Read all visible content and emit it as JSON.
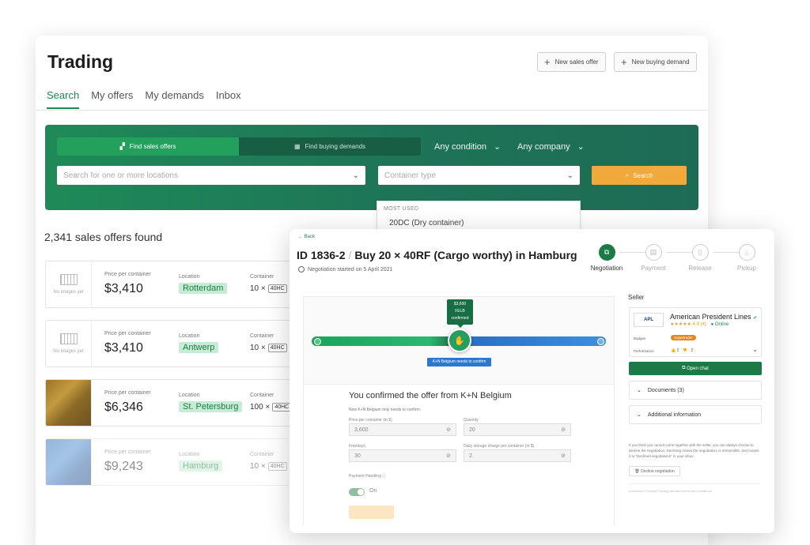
{
  "back_window": {
    "title": "Trading",
    "buttons": {
      "new_sales_offer": "New sales offer",
      "new_buying_demand": "New buying demand"
    },
    "tabs": [
      {
        "label": "Search",
        "active": true
      },
      {
        "label": "My offers",
        "active": false
      },
      {
        "label": "My demands",
        "active": false
      },
      {
        "label": "Inbox",
        "active": false
      }
    ],
    "search": {
      "find_sales": "Find sales offers",
      "find_buying": "Find buying demands",
      "condition": "Any condition",
      "company": "Any company",
      "location_placeholder": "Search for one or more locations",
      "container_placeholder": "Container type",
      "search_button": "Search",
      "dropdown_header": "MOST USED",
      "dropdown_option": "20DC (Dry container)"
    },
    "results_count": "2,341 sales offers found",
    "cards": [
      {
        "image_label": "No images yet",
        "price_label": "Price per container",
        "price": "$3,410",
        "location_label": "Location",
        "location": "Rotterdam",
        "container_label": "Container",
        "qty": "10 ×",
        "type": "40HC"
      },
      {
        "image_label": "No images yet",
        "price_label": "Price per container",
        "price": "$3,410",
        "location_label": "Location",
        "location": "Antwerp",
        "container_label": "Container",
        "qty": "10 ×",
        "type": "40HC"
      },
      {
        "image_label": "",
        "price_label": "Price per container",
        "price": "$6,346",
        "location_label": "Location",
        "location": "St. Petersburg",
        "container_label": "Container",
        "qty": "100 ×",
        "type": "40HC"
      },
      {
        "image_label": "",
        "price_label": "Price per container",
        "price": "$9,243",
        "location_label": "Location",
        "location": "Hamburg",
        "container_label": "Container",
        "qty": "10 ×",
        "type": "40HC"
      }
    ]
  },
  "front_window": {
    "back": "Back",
    "id": "ID 1836-2",
    "title": "Buy 20 × 40RF (Cargo worthy) in Hamburg",
    "started": "Negotiation started on 5 April 2021",
    "steps": [
      {
        "label": "Negotiation",
        "active": true
      },
      {
        "label": "Payment",
        "active": false
      },
      {
        "label": "Release",
        "active": false
      },
      {
        "label": "Pickup",
        "active": false
      }
    ],
    "flag": {
      "price": "$3,600",
      "term": "FELB",
      "status": "confirmed"
    },
    "needs_confirm": "K+N Belgium needs to confirm",
    "confirm_title": "You confirmed the offer from K+N Belgium",
    "confirm_sub": "Now K+N Belgium only needs to confirm.",
    "fields": {
      "price_label": "Price per container (in $)",
      "price": "3,600",
      "quantity_label": "Quantity",
      "quantity": "20",
      "freedays_label": "Freedays",
      "freedays": "30",
      "storage_label": "Daily storage charge per container (in $)",
      "storage": "2"
    },
    "payment_label": "Payment Handling",
    "toggle_state": "On",
    "seller": {
      "heading": "Seller",
      "logo": "APL",
      "name": "American President Lines",
      "rating": "★★★★★ 4.9 (4)",
      "online": "Online",
      "badges_label": "Badges",
      "badge": "Supertrader",
      "performance_label": "Performance",
      "perf_pos": "2",
      "perf_neg": "2",
      "open_chat": "Open chat",
      "documents": "Documents (3)",
      "additional": "Additional information",
      "decline_note": "If you think you cannot come together with the seller, you can always choose to decline the negotiation. Declining closes the negotiation, is irreversible, and moves it to \"Declined negotiations\" in your inbox.",
      "decline_button": "Decline negotiation",
      "download_note": "Download XChange Trading standard terms and conditions"
    }
  }
}
